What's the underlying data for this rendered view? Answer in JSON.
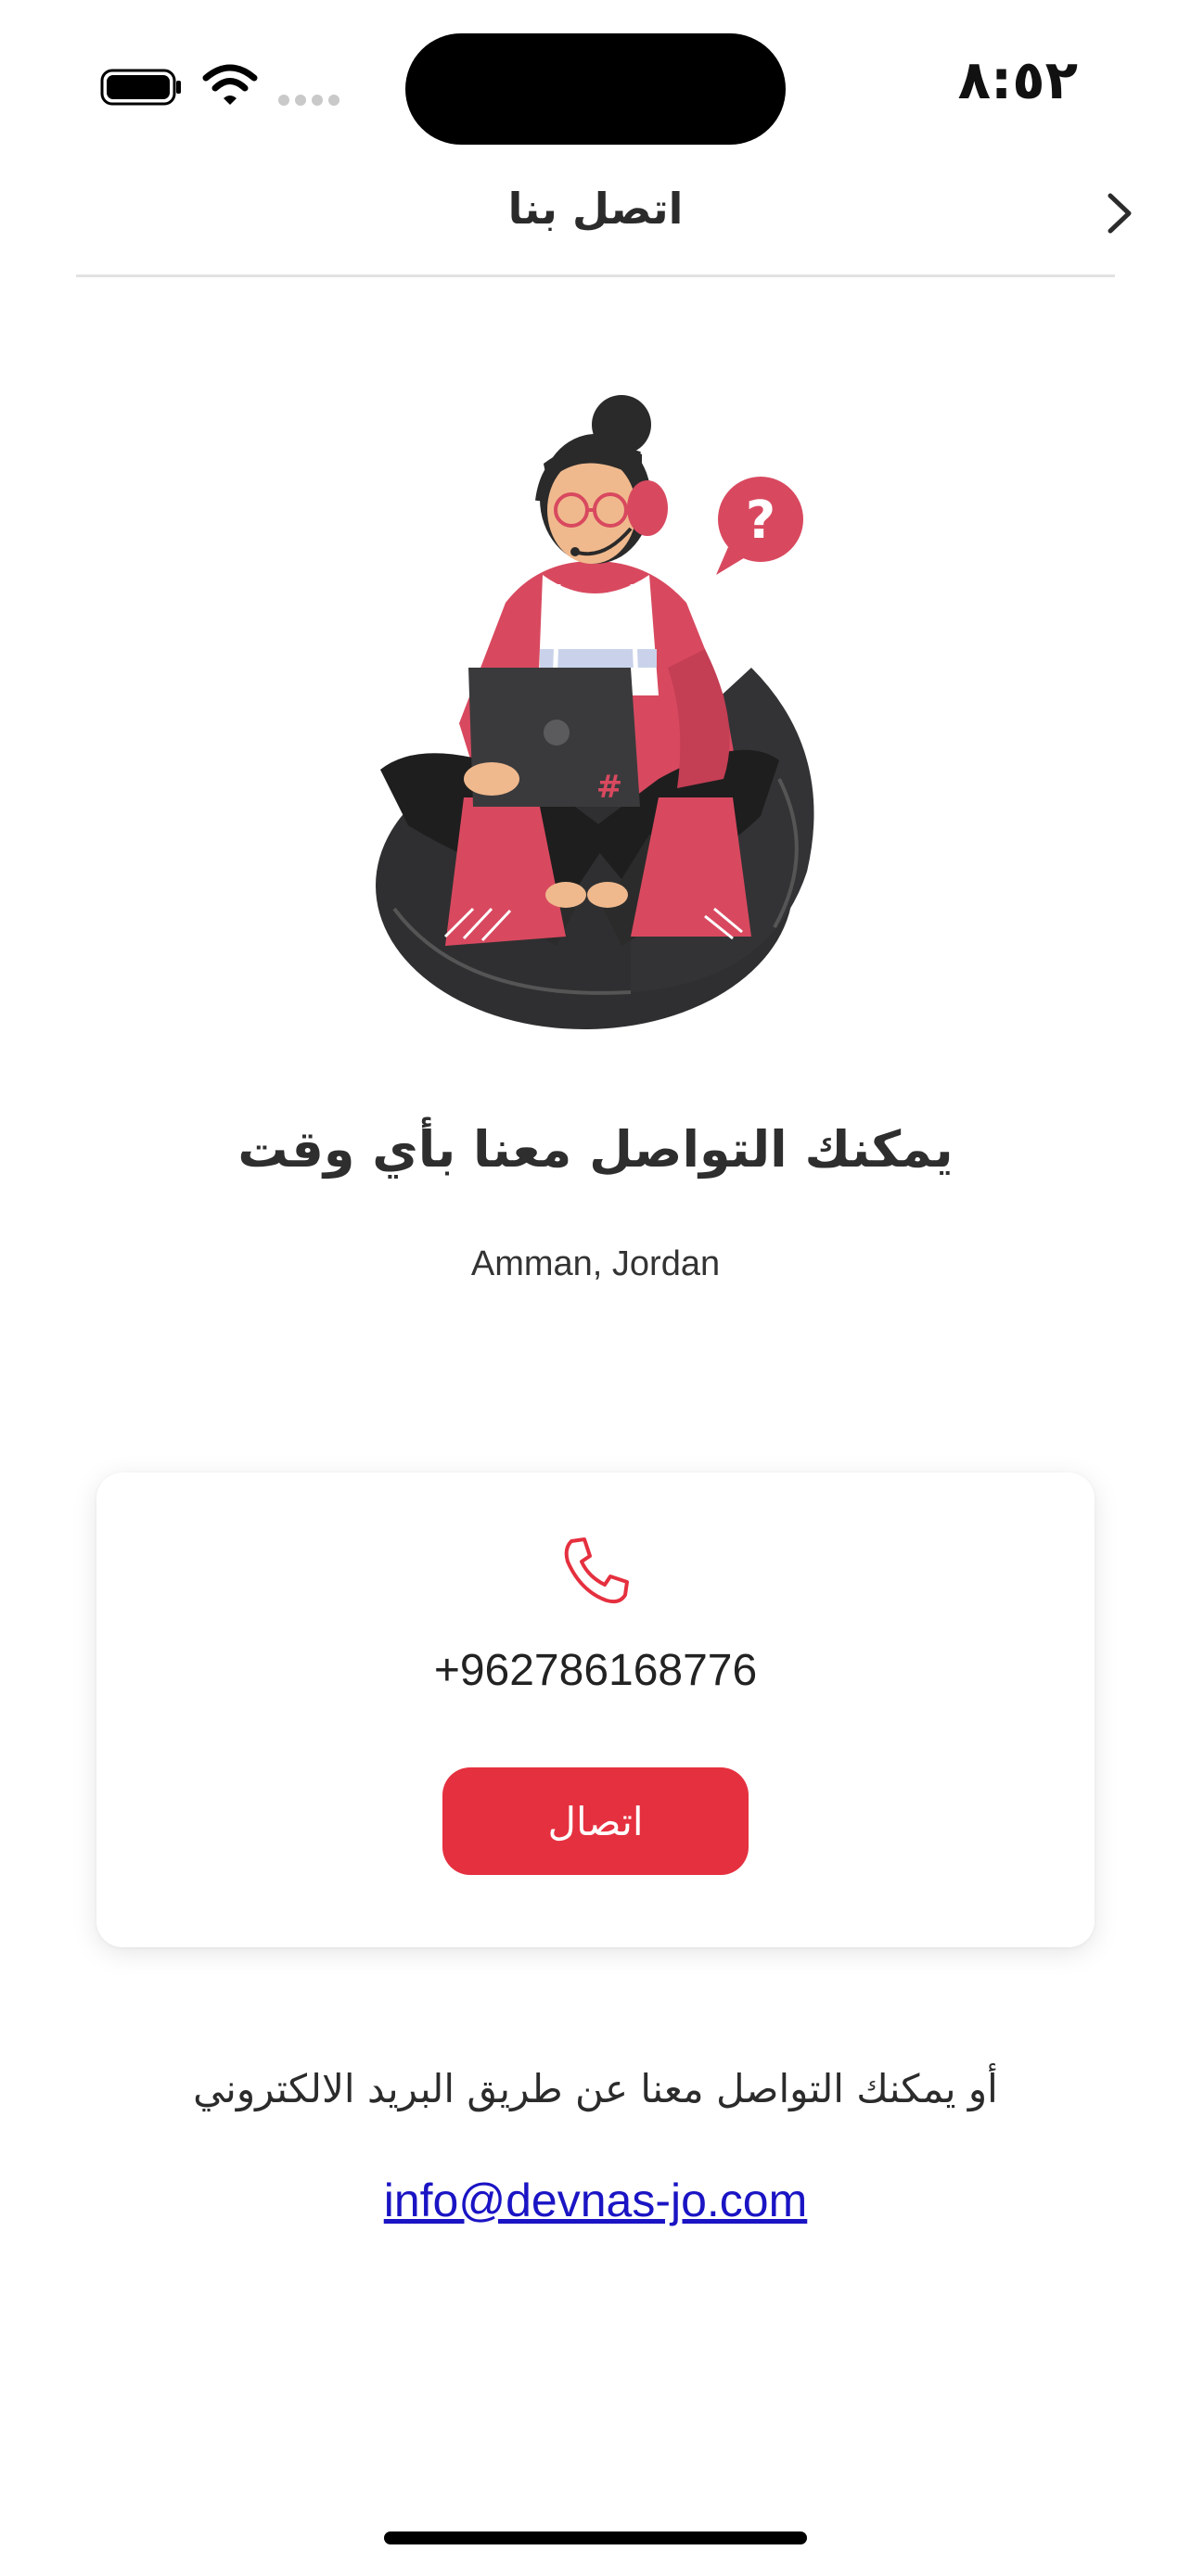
{
  "status_bar": {
    "time": "٨:٥٢",
    "icons": [
      "battery-icon",
      "wifi-icon",
      "signal-icon"
    ]
  },
  "nav": {
    "title": "اتصل بنا",
    "back_icon": "chevron-right-icon"
  },
  "hero": {
    "illustration": "support-agent-illustration",
    "headline": "يمكنك التواصل معنا بأي وقت",
    "location": "Amman, Jordan"
  },
  "contact_card": {
    "icon": "phone-icon",
    "phone_number": "+962786168776",
    "call_button_label": "اتصال"
  },
  "email_section": {
    "caption": "أو يمكنك التواصل معنا عن طريق البريد الالكتروني",
    "email": "info@devnas-jo.com"
  },
  "colors": {
    "accent": "#e5303f",
    "illustration_red": "#d8495f",
    "link": "#1a14c4",
    "text": "#2b2b2b"
  }
}
